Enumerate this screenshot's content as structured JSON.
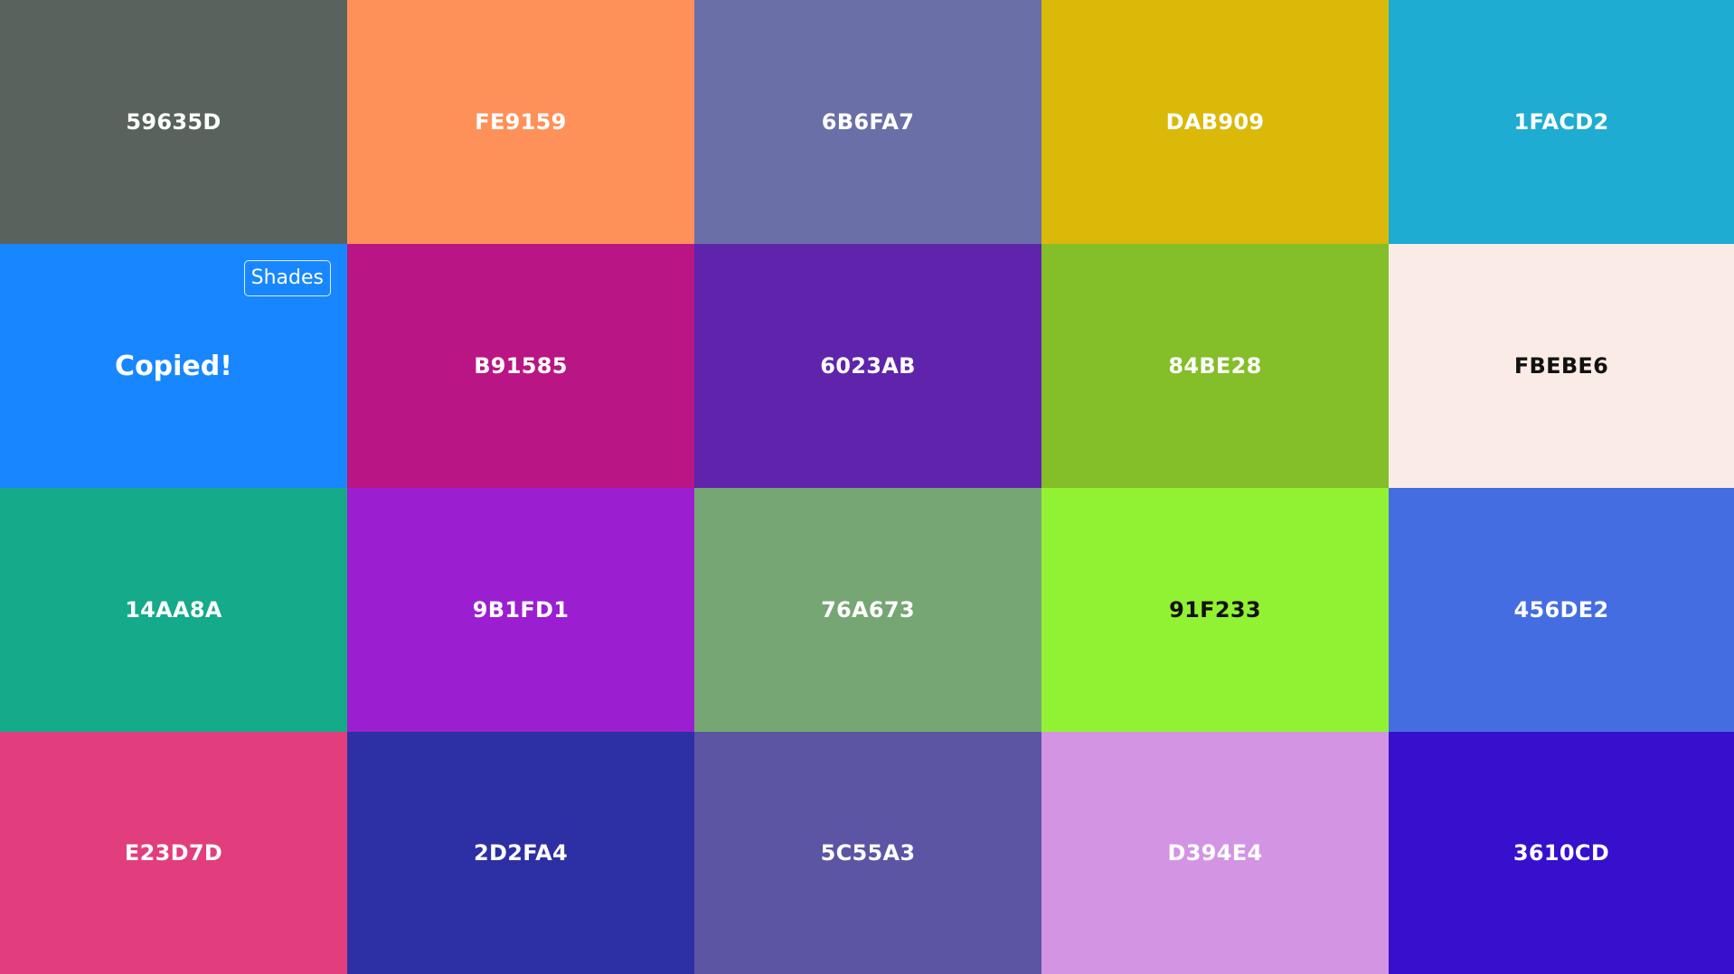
{
  "palette": {
    "swatches": [
      {
        "hex": "59635D",
        "color": "#59635D",
        "text_color": "light"
      },
      {
        "hex": "FE9159",
        "color": "#FE9159",
        "text_color": "light"
      },
      {
        "hex": "6B6FA7",
        "color": "#6B6FA7",
        "text_color": "light"
      },
      {
        "hex": "DAB909",
        "color": "#DAB909",
        "text_color": "light"
      },
      {
        "hex": "1FACD2",
        "color": "#1FACD2",
        "text_color": "light"
      },
      {
        "hex": "",
        "color": "#1887FF",
        "text_color": "light",
        "status": "Copied!",
        "shades_label": "Shades"
      },
      {
        "hex": "B91585",
        "color": "#B91585",
        "text_color": "light"
      },
      {
        "hex": "6023AB",
        "color": "#6023AB",
        "text_color": "light"
      },
      {
        "hex": "84BE28",
        "color": "#84BE28",
        "text_color": "light"
      },
      {
        "hex": "FBEBE6",
        "color": "#FBEBE6",
        "text_color": "dark"
      },
      {
        "hex": "14AA8A",
        "color": "#14AA8A",
        "text_color": "light"
      },
      {
        "hex": "9B1FD1",
        "color": "#9B1FD1",
        "text_color": "light"
      },
      {
        "hex": "76A673",
        "color": "#76A673",
        "text_color": "light"
      },
      {
        "hex": "91F233",
        "color": "#91F233",
        "text_color": "dark"
      },
      {
        "hex": "456DE2",
        "color": "#456DE2",
        "text_color": "light"
      },
      {
        "hex": "E23D7D",
        "color": "#E23D7D",
        "text_color": "light"
      },
      {
        "hex": "2D2FA4",
        "color": "#2D2FA4",
        "text_color": "light"
      },
      {
        "hex": "5C55A3",
        "color": "#5C55A3",
        "text_color": "light"
      },
      {
        "hex": "D394E4",
        "color": "#D394E4",
        "text_color": "light"
      },
      {
        "hex": "3610CD",
        "color": "#3610CD",
        "text_color": "light"
      }
    ]
  }
}
